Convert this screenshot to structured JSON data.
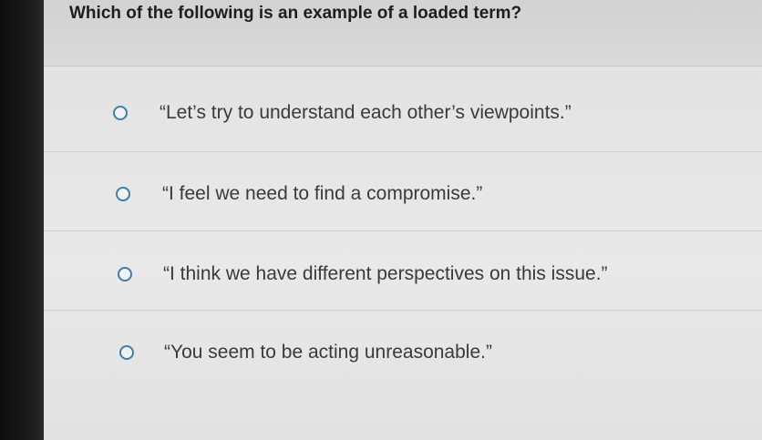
{
  "question": {
    "text": "Which of the following is an example of a loaded term?"
  },
  "options": [
    {
      "label": "“Let’s try to understand each other’s viewpoints.”",
      "selected": false
    },
    {
      "label": "“I feel we need to find a compromise.”",
      "selected": false
    },
    {
      "label": "“I think we have different perspectives on this issue.”",
      "selected": false
    },
    {
      "label": "“You seem to be acting unreasonable.”",
      "selected": false
    }
  ],
  "colors": {
    "radio_border": "#3a7fb0",
    "question_text": "#1e1e1e",
    "option_text": "#3a3a3a"
  }
}
